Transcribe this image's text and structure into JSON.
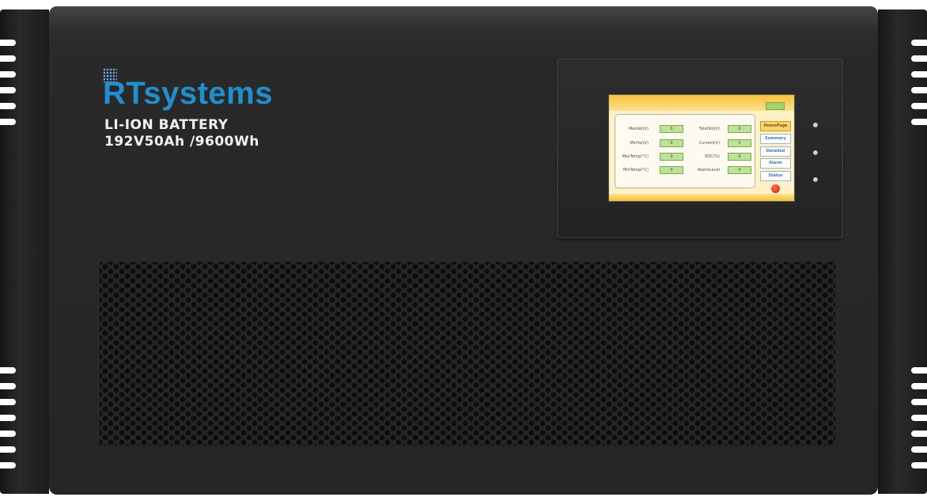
{
  "brand": {
    "logo_text": "RTsystems"
  },
  "product": {
    "line1": "LI-ION BATTERY",
    "line2": "192V50Ah /9600Wh"
  },
  "display": {
    "parameters": [
      {
        "label": "MaxVol(V)",
        "value": "0"
      },
      {
        "label": "MinVol(V)",
        "value": "0"
      },
      {
        "label": "MaxTemp(°C)",
        "value": "0"
      },
      {
        "label": "MinTemp(°C)",
        "value": "0"
      },
      {
        "label": "TotalVol(V)",
        "value": "0"
      },
      {
        "label": "Current(V)",
        "value": "0"
      },
      {
        "label": "SOC(%)",
        "value": "0"
      },
      {
        "label": "AlarmLevel",
        "value": "0"
      }
    ],
    "nav": [
      {
        "label": "HomePage",
        "active": true
      },
      {
        "label": "Summary",
        "active": false
      },
      {
        "label": "Detailed",
        "active": false
      },
      {
        "label": "Alarm",
        "active": false
      },
      {
        "label": "Status",
        "active": false
      }
    ]
  },
  "colors": {
    "chassis": "#262626",
    "logo_blue": "#1f8fd0",
    "lcd_yellow": "#f5c23c",
    "value_green": "#bde39a",
    "stop_red": "#d0200e"
  }
}
